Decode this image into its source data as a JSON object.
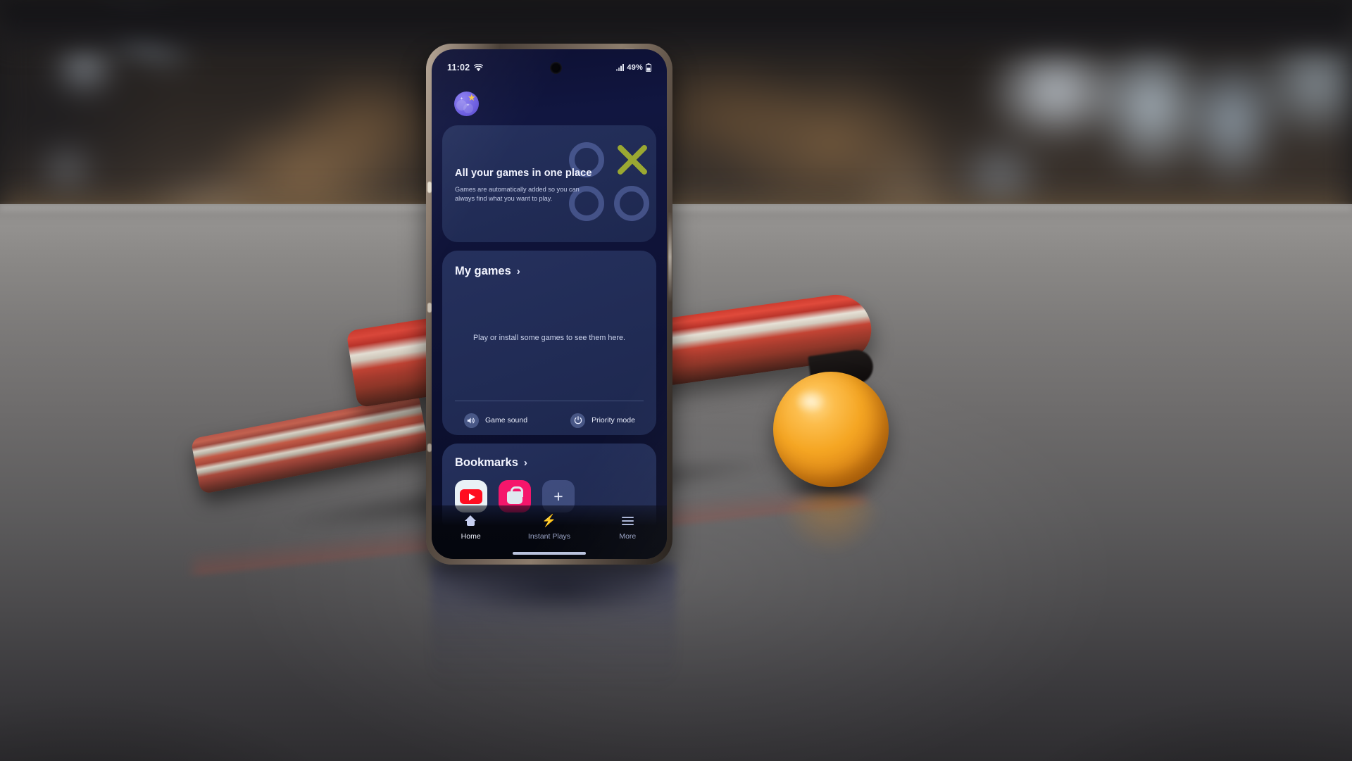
{
  "scene": {
    "description": "Smartphone on a desk with ping pong paddle and orange ball",
    "objects": [
      "ping-pong-paddle",
      "ping-pong-ball",
      "smartphone"
    ]
  },
  "phone": {
    "status_bar": {
      "time": "11:02",
      "wifi_icon": "wifi-icon",
      "signal_icon": "signal-bars-icon",
      "battery_percent": "49%",
      "battery_icon": "battery-icon"
    },
    "app_icon_name": "game-launcher-profile-icon",
    "banner": {
      "title": "All your games in one place",
      "subtitle": "Games are automatically added so you can always find what you want to play.",
      "graphic": "tic-tac-toe-graphic"
    },
    "my_games": {
      "title": "My games",
      "chevron": "›",
      "empty_message": "Play or install some games to see them here.",
      "quick_actions": [
        {
          "label": "Game sound",
          "icon": "speaker-icon",
          "glyph": "🔊"
        },
        {
          "label": "Priority mode",
          "icon": "power-icon",
          "glyph": "⏻"
        }
      ]
    },
    "bookmarks": {
      "title": "Bookmarks",
      "chevron": "›",
      "items": [
        {
          "name": "youtube",
          "label": "YouTube"
        },
        {
          "name": "galaxy-store",
          "label": "Galaxy Store"
        },
        {
          "name": "add-bookmark",
          "label": "+"
        }
      ]
    },
    "bottom_nav": [
      {
        "label": "Home",
        "icon": "home-icon",
        "active": true
      },
      {
        "label": "Instant Plays",
        "icon": "bolt-icon",
        "active": false
      },
      {
        "label": "More",
        "icon": "menu-icon",
        "active": false
      }
    ]
  },
  "colors": {
    "screen_bg": "#0f1338",
    "card_bg": "#273360",
    "accent_yellow": "#9aa832",
    "youtube_red": "#ff0d20",
    "store_pink": "#f5166b",
    "ball_orange": "#f5a623",
    "paddle_red": "#c83a2e"
  }
}
